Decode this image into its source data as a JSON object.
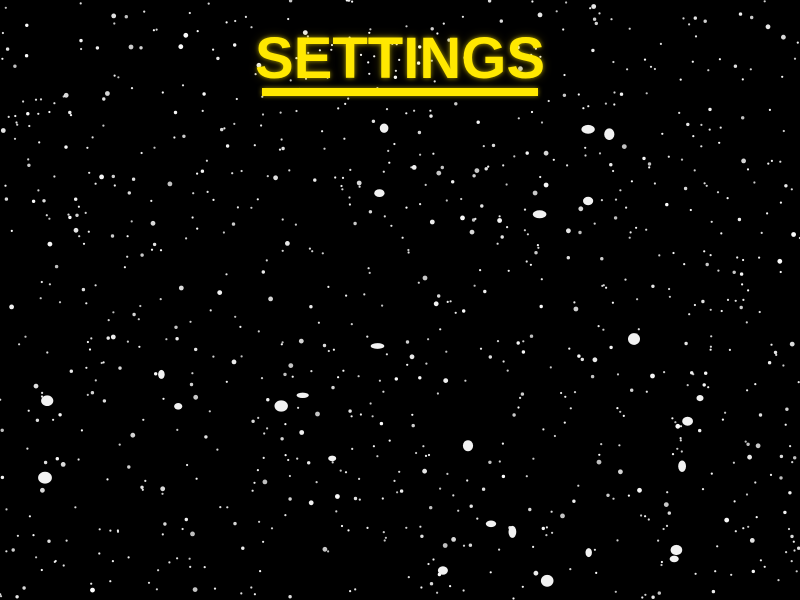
{
  "screen": {
    "title": "SETTINGS",
    "accent_color": "#ffe800",
    "background_color": "#000000",
    "background": "starfield"
  }
}
